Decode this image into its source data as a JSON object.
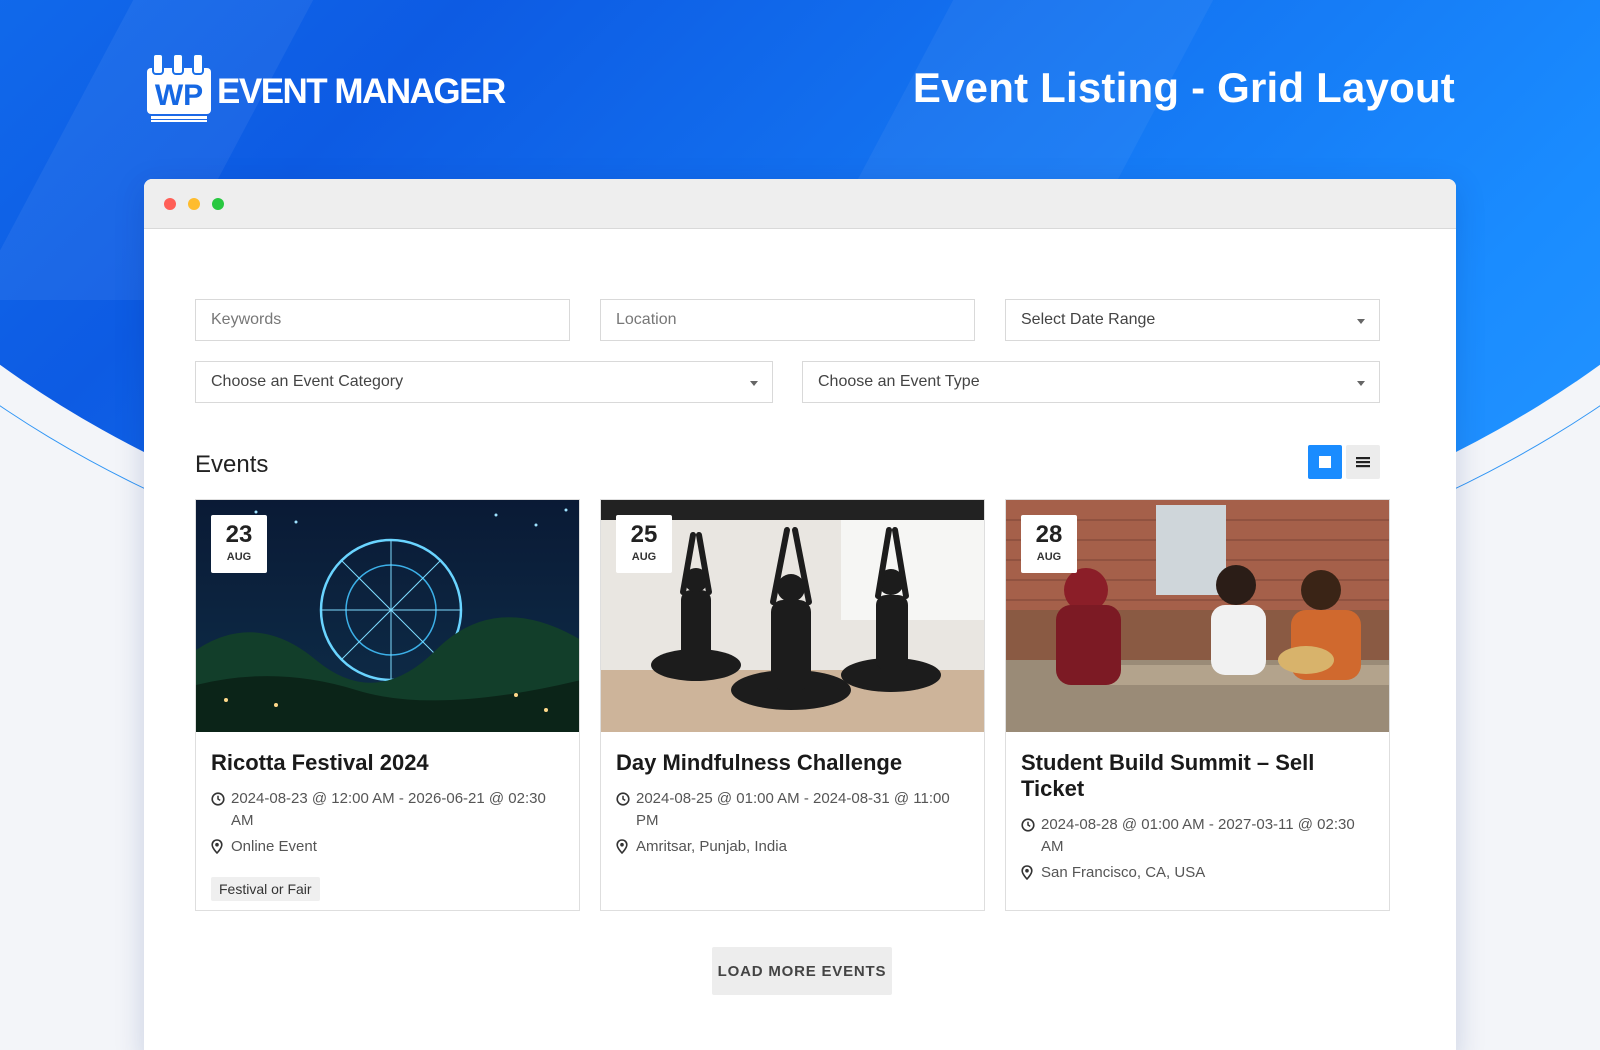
{
  "brand": {
    "logo_text": "EVENT MANAGER",
    "logo_mark_text": "WP"
  },
  "header": {
    "title": "Event Listing - Grid Layout"
  },
  "filters": {
    "keywords_placeholder": "Keywords",
    "location_placeholder": "Location",
    "date_range": "Select Date Range",
    "category": "Choose an Event Category",
    "type": "Choose an Event Type"
  },
  "events": {
    "heading": "Events",
    "view_modes": [
      "grid",
      "list"
    ],
    "active_view": "grid",
    "cards": [
      {
        "day": "23",
        "month": "AUG",
        "title": "Ricotta Festival 2024",
        "datetime": "2024-08-23 @ 12:00 AM - 2026-06-21 @ 02:30 AM",
        "location": "Online Event",
        "tag": "Festival or Fair"
      },
      {
        "day": "25",
        "month": "AUG",
        "title": "Day Mindfulness Challenge",
        "datetime": "2024-08-25 @ 01:00 AM - 2024-08-31 @ 11:00 PM",
        "location": "Amritsar, Punjab, India",
        "tag": ""
      },
      {
        "day": "28",
        "month": "AUG",
        "title": "Student Build Summit – Sell Ticket",
        "datetime": "2024-08-28 @ 01:00 AM - 2027-03-11 @ 02:30 AM",
        "location": "San Francisco, CA, USA",
        "tag": ""
      }
    ],
    "load_more": "LOAD MORE EVENTS"
  },
  "colors": {
    "accent": "#1a8cff",
    "hero_dark": "#0d5be3",
    "dot_red": "#ff5f57",
    "dot_yellow": "#febc2e",
    "dot_green": "#28c840"
  }
}
